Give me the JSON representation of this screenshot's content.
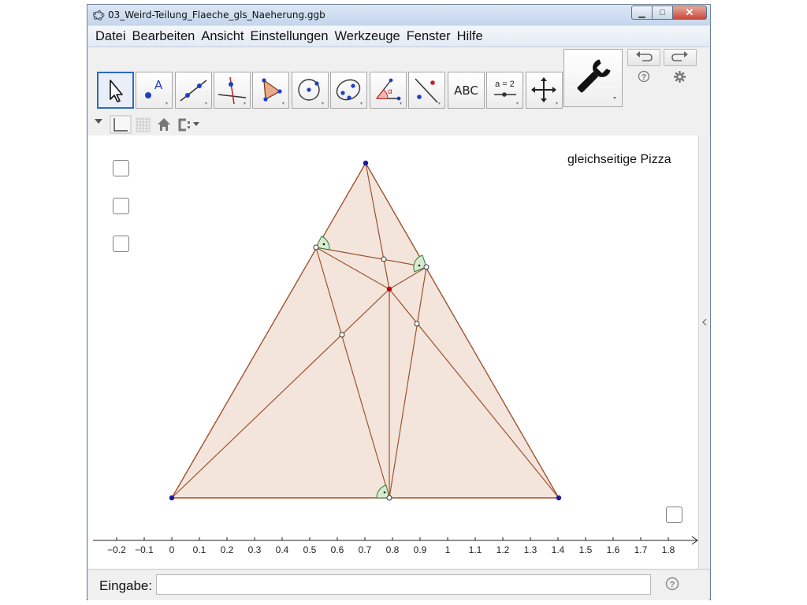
{
  "window": {
    "title": "03_Weird-Teilung_Flaeche_gls_Naeherung.ggb",
    "minimize_glyph": "▁",
    "maximize_glyph": "□",
    "close_glyph": "✕"
  },
  "menu": {
    "items": [
      "Datei",
      "Bearbeiten",
      "Ansicht",
      "Einstellungen",
      "Werkzeuge",
      "Fenster",
      "Hilfe"
    ]
  },
  "toolbar": {
    "tools": [
      {
        "name": "move-tool",
        "icon": "cursor-arrow-icon"
      },
      {
        "name": "point-tool",
        "icon": "point-icon",
        "label": "A"
      },
      {
        "name": "line-tool",
        "icon": "line-through-points-icon"
      },
      {
        "name": "perpendicular-line-tool",
        "icon": "perpendicular-line-icon"
      },
      {
        "name": "polygon-tool",
        "icon": "polygon-icon"
      },
      {
        "name": "circle-tool",
        "icon": "circle-center-point-icon"
      },
      {
        "name": "conic-tool",
        "icon": "ellipse-icon"
      },
      {
        "name": "angle-tool",
        "icon": "angle-icon",
        "label": "α"
      },
      {
        "name": "reflect-tool",
        "icon": "reflect-about-line-icon"
      },
      {
        "name": "text-tool",
        "icon": "text-icon",
        "label": "ABC"
      },
      {
        "name": "slider-tool",
        "icon": "slider-icon",
        "label": "a = 2"
      },
      {
        "name": "move-graphics-tool",
        "icon": "move-graphics-view-icon"
      }
    ],
    "big_tool_icon": "wrench-icon",
    "undo_icon": "undo-icon",
    "redo_icon": "redo-icon",
    "help_icon": "help-icon",
    "settings_icon": "gear-icon"
  },
  "graphics": {
    "text_label": "gleichseitige Pizza",
    "fill_color": "#f3e5dc",
    "line_color": "#a0522d",
    "vertex_color": "#1a1aa0",
    "center_color": "#c00000",
    "angle_color": "#2e7d32",
    "axis_ticks": [
      "−0.2",
      "−0.1",
      "0",
      "0.1",
      "0.2",
      "0.3",
      "0.4",
      "0.5",
      "0.6",
      "0.7",
      "0.8",
      "0.9",
      "1",
      "1.1",
      "1.2",
      "1.3",
      "1.4",
      "1.5",
      "1.6",
      "1.7",
      "1.8"
    ]
  },
  "inputbar": {
    "label": "Eingabe:",
    "value": "",
    "placeholder": ""
  }
}
